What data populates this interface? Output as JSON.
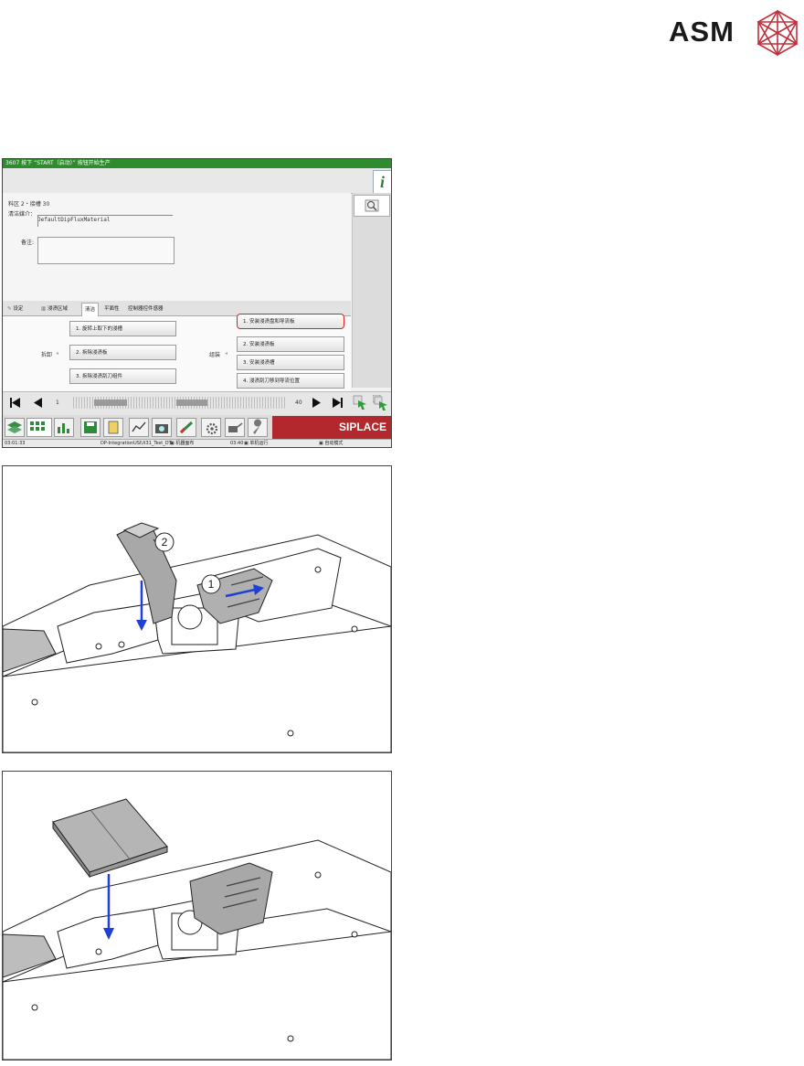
{
  "logo": {
    "text": "ASM"
  },
  "screen": {
    "status_strip": "3607 按下 “START（启动）” 按钮开始生产",
    "form": {
      "location": "料区 2・接槽 30",
      "material_label": "清洁媒介：",
      "material_value": "DefaultDipFluxMaterial",
      "remark_label": "备注:"
    },
    "tabs": [
      "设定",
      "浸渍区域",
      "清洁",
      "平面性",
      "控制器控件感器"
    ],
    "steps": {
      "left_group_label": "拆卸",
      "right_group_label": "组装",
      "left": [
        "1. 旋转上取下的浸槽",
        "2. 拆除浸渍板",
        "3. 拆除浸渍刮刀组件"
      ],
      "right": [
        "1. 安装浸渍盘和导流板",
        "2. 安装浸渍板",
        "3. 安装浸渍槽",
        "4. 浸渍刮刀移到导流位置"
      ]
    },
    "nav": {
      "left_value": "1",
      "right_value": "40"
    },
    "brand_panel": "SIPLACE",
    "bottom_status": [
      "03:01:33",
      "DP-IntegrationUSI\\X31_Test_DT",
      "机器面布",
      "03:40",
      "单机运行",
      "自动模式"
    ]
  },
  "figures": {
    "fig1_callouts": [
      "1",
      "2"
    ]
  },
  "colors": {
    "status_green": "#2e8b2e",
    "siplace_red": "#b2282d",
    "highlight_red": "#e02020",
    "arrow_blue": "#1f3fd6",
    "logo_red": "#c0303a"
  }
}
